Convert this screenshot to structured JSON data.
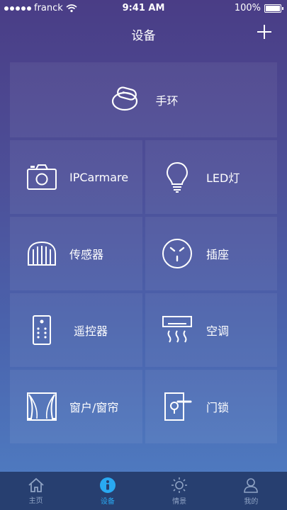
{
  "status_bar": {
    "carrier": "franck",
    "time": "9:41 AM",
    "battery": "100%"
  },
  "header": {
    "title": "设备",
    "add_icon": "plus-icon"
  },
  "devices": {
    "featured": {
      "label": "手环",
      "icon": "wristband-icon"
    },
    "items": [
      {
        "label": "IPCarmare",
        "icon": "camera-icon"
      },
      {
        "label": "LED灯",
        "icon": "bulb-icon"
      },
      {
        "label": "传感器",
        "icon": "sensor-icon"
      },
      {
        "label": "插座",
        "icon": "socket-icon"
      },
      {
        "label": "遥控器",
        "icon": "remote-icon"
      },
      {
        "label": "空调",
        "icon": "air-conditioner-icon"
      },
      {
        "label": "窗户/窗帘",
        "icon": "curtain-icon"
      },
      {
        "label": "门锁",
        "icon": "door-lock-icon"
      }
    ]
  },
  "tabs": [
    {
      "label": "主页",
      "icon": "home-icon"
    },
    {
      "label": "设备",
      "icon": "device-icon",
      "active": true
    },
    {
      "label": "情景",
      "icon": "scene-icon"
    },
    {
      "label": "我的",
      "icon": "profile-icon"
    }
  ],
  "colors": {
    "tab_active": "#29a9f2",
    "tabbar": "#273f70"
  }
}
